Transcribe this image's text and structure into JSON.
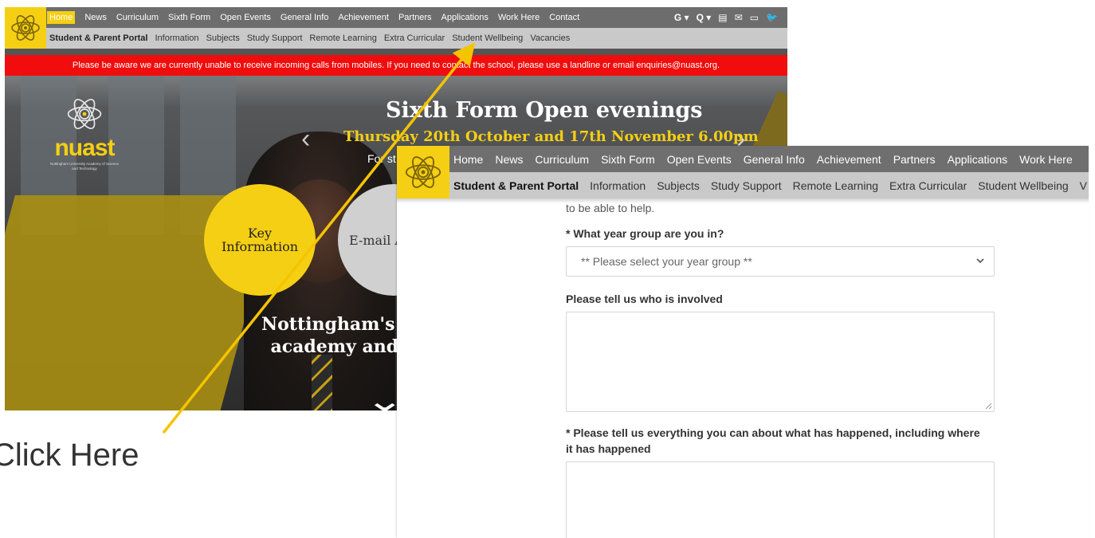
{
  "shot1": {
    "nav": {
      "items": [
        "Home",
        "News",
        "Curriculum",
        "Sixth Form",
        "Open Events",
        "General Info",
        "Achievement",
        "Partners",
        "Applications",
        "Work Here",
        "Contact"
      ],
      "active_index": 0,
      "icons": [
        "google-translate-icon",
        "search-icon",
        "calendar-icon",
        "mail-icon",
        "monitor-icon",
        "twitter-icon"
      ],
      "icon_glyphs": [
        "G ▾",
        "Q ▾",
        "▤",
        "✉",
        "▭",
        "🐦"
      ]
    },
    "subnav": {
      "items": [
        "Student & Parent Portal",
        "Information",
        "Subjects",
        "Study Support",
        "Remote Learning",
        "Extra Curricular",
        "Student Wellbeing",
        "Vacancies"
      ]
    },
    "alert": {
      "text": "Please be aware we are currently unable to receive incoming calls from mobiles. If you need to contact the school, please use a landline or email enquiries@nuast.org."
    },
    "hero": {
      "logo_word": "nuast",
      "logo_sub": "Nottingham University Academy of Science and Technology",
      "title": "Sixth Form Open evenings",
      "subtitle": "Thursday 20th October and 17th November 6.00pm",
      "small_text": "For st",
      "key_info_line1": "Key",
      "key_info_line2": "Information",
      "email_text": "E-mail A",
      "tagline_line1": "Nottingham's l",
      "tagline_line2": "academy and",
      "prev_glyph": "‹",
      "next_glyph": "›",
      "down_glyph": "⌄"
    }
  },
  "annotation": {
    "click_here": "Click Here",
    "arrow_color": "#f5c400"
  },
  "shot2": {
    "nav": {
      "items": [
        "Home",
        "News",
        "Curriculum",
        "Sixth Form",
        "Open Events",
        "General Info",
        "Achievement",
        "Partners",
        "Applications",
        "Work Here"
      ]
    },
    "subnav": {
      "items": [
        "Student & Parent Portal",
        "Information",
        "Subjects",
        "Study Support",
        "Remote Learning",
        "Extra Curricular",
        "Student Wellbeing",
        "V"
      ]
    },
    "form": {
      "cut_text": "to be able to help.",
      "year_label": "* What year group are you in?",
      "year_placeholder": "** Please select your year group **",
      "who_label": "Please tell us who is involved",
      "what_label_line1": "* Please tell us everything you can about what has happened, including where",
      "what_label_line2": "it has happened"
    }
  },
  "colors": {
    "brand_yellow": "#f5cf13",
    "nav_grey": "#6d6d6d",
    "subnav_grey": "#c9c9c9",
    "alert_red": "#f10d0d"
  }
}
